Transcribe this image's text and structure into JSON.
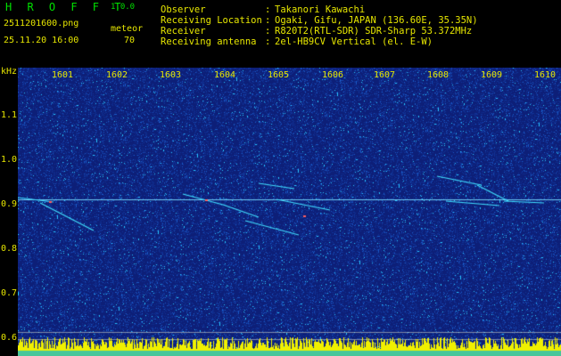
{
  "app": {
    "name": "H R O F F T",
    "version": "1.0.0",
    "filename": "2511201600.png",
    "datetime": "25.11.20 16:00",
    "count_label": "meteor",
    "count_value": "70"
  },
  "info": [
    {
      "label": "Observer",
      "value": "Takanori Kawachi"
    },
    {
      "label": "Receiving Location",
      "value": "Ogaki, Gifu, JAPAN (136.60E, 35.35N)"
    },
    {
      "label": "Receiver",
      "value": "R820T2(RTL-SDR) SDR-Sharp 53.372MHz"
    },
    {
      "label": "Receiving antenna",
      "value": "2el-HB9CV Vertical (el. E-W)"
    }
  ],
  "y_axis": {
    "unit": "kHz",
    "ticks": [
      "1.1",
      "1.0",
      "0.9",
      "0.8",
      "0.7",
      "0.6"
    ]
  },
  "x_axis": {
    "ticks": [
      "1601",
      "1602",
      "1603",
      "1604",
      "1605",
      "1606",
      "1607",
      "1608",
      "1609",
      "1610"
    ]
  },
  "colors": {
    "text_yellow": "#e6e600",
    "title_green": "#00e000",
    "spectrogram_bg": "#0d1f78",
    "trace": "#40e0ff",
    "base_band": "#f0f000"
  }
}
